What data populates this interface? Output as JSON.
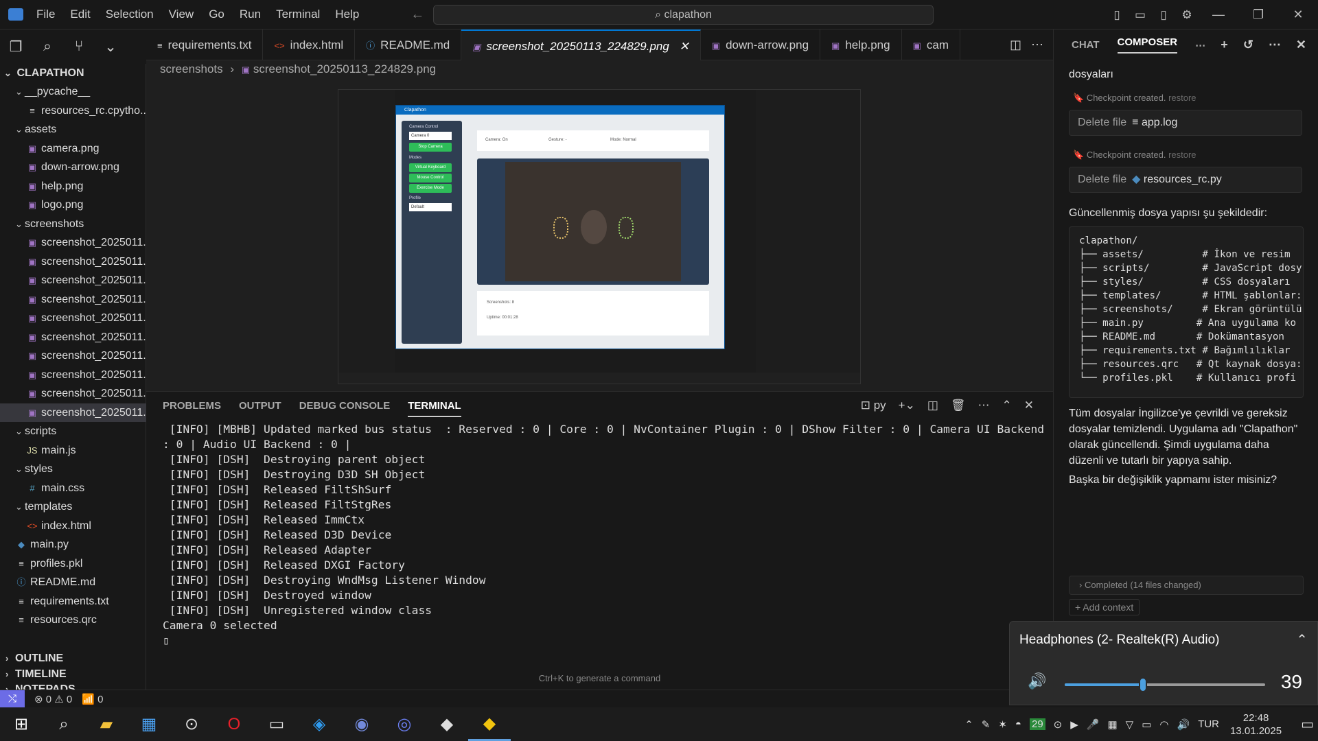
{
  "window": {
    "menu": [
      "File",
      "Edit",
      "Selection",
      "View",
      "Go",
      "Run",
      "Terminal",
      "Help"
    ],
    "command_center": "clapathon"
  },
  "explorer": {
    "root": "CLAPATHON",
    "items": [
      {
        "depth": 1,
        "kind": "folder",
        "label": "__pycache__",
        "icon": "chevron"
      },
      {
        "depth": 2,
        "kind": "file",
        "label": "resources_rc.cpytho...",
        "icon": "txt"
      },
      {
        "depth": 1,
        "kind": "folder",
        "label": "assets",
        "icon": "chevron"
      },
      {
        "depth": 2,
        "kind": "file",
        "label": "camera.png",
        "icon": "img"
      },
      {
        "depth": 2,
        "kind": "file",
        "label": "down-arrow.png",
        "icon": "img"
      },
      {
        "depth": 2,
        "kind": "file",
        "label": "help.png",
        "icon": "img"
      },
      {
        "depth": 2,
        "kind": "file",
        "label": "logo.png",
        "icon": "img"
      },
      {
        "depth": 1,
        "kind": "folder",
        "label": "screenshots",
        "icon": "chevron"
      },
      {
        "depth": 2,
        "kind": "file",
        "label": "screenshot_2025011...",
        "icon": "img"
      },
      {
        "depth": 2,
        "kind": "file",
        "label": "screenshot_2025011...",
        "icon": "img"
      },
      {
        "depth": 2,
        "kind": "file",
        "label": "screenshot_2025011...",
        "icon": "img"
      },
      {
        "depth": 2,
        "kind": "file",
        "label": "screenshot_2025011...",
        "icon": "img"
      },
      {
        "depth": 2,
        "kind": "file",
        "label": "screenshot_2025011...",
        "icon": "img"
      },
      {
        "depth": 2,
        "kind": "file",
        "label": "screenshot_2025011...",
        "icon": "img"
      },
      {
        "depth": 2,
        "kind": "file",
        "label": "screenshot_2025011...",
        "icon": "img"
      },
      {
        "depth": 2,
        "kind": "file",
        "label": "screenshot_2025011...",
        "icon": "img"
      },
      {
        "depth": 2,
        "kind": "file",
        "label": "screenshot_2025011...",
        "icon": "img"
      },
      {
        "depth": 2,
        "kind": "file",
        "label": "screenshot_2025011...",
        "icon": "img",
        "selected": true
      },
      {
        "depth": 1,
        "kind": "folder",
        "label": "scripts",
        "icon": "chevron"
      },
      {
        "depth": 2,
        "kind": "file",
        "label": "main.js",
        "icon": "js"
      },
      {
        "depth": 1,
        "kind": "folder",
        "label": "styles",
        "icon": "chevron"
      },
      {
        "depth": 2,
        "kind": "file",
        "label": "main.css",
        "icon": "css"
      },
      {
        "depth": 1,
        "kind": "folder",
        "label": "templates",
        "icon": "chevron"
      },
      {
        "depth": 2,
        "kind": "file",
        "label": "index.html",
        "icon": "html"
      },
      {
        "depth": 1,
        "kind": "file",
        "label": "main.py",
        "icon": "py"
      },
      {
        "depth": 1,
        "kind": "file",
        "label": "profiles.pkl",
        "icon": "txt"
      },
      {
        "depth": 1,
        "kind": "file",
        "label": "README.md",
        "icon": "info"
      },
      {
        "depth": 1,
        "kind": "file",
        "label": "requirements.txt",
        "icon": "txt"
      },
      {
        "depth": 1,
        "kind": "file",
        "label": "resources.qrc",
        "icon": "txt"
      }
    ],
    "sections": [
      "OUTLINE",
      "TIMELINE",
      "NOTEPADS"
    ]
  },
  "tabs": [
    {
      "label": "requirements.txt",
      "icon": "txt"
    },
    {
      "label": "index.html",
      "icon": "html"
    },
    {
      "label": "README.md",
      "icon": "info"
    },
    {
      "label": "screenshot_20250113_224829.png",
      "icon": "img",
      "active": true
    },
    {
      "label": "down-arrow.png",
      "icon": "img"
    },
    {
      "label": "help.png",
      "icon": "img"
    },
    {
      "label": "cam",
      "icon": "img"
    }
  ],
  "breadcrumb": {
    "folder": "screenshots",
    "file": "screenshot_20250113_224829.png"
  },
  "preview": {
    "app_title": "Clapathon",
    "camera_control": "Camera Control",
    "camera_select": "Camera 0",
    "stop_camera": "Stop Camera",
    "modes": "Modes",
    "mode_buttons": [
      "Virtual Keyboard",
      "Mouse Control",
      "Exercise Mode"
    ],
    "profile": "Profile",
    "profile_value": "Default",
    "status_camera": "Camera: On",
    "status_gesture": "Gesture: -",
    "status_mode": "Mode: Normal",
    "screenshots": "Screenshots: 8",
    "uptime": "Uptime: 00:01:28"
  },
  "panel": {
    "tabs": [
      "PROBLEMS",
      "OUTPUT",
      "DEBUG CONSOLE",
      "TERMINAL"
    ],
    "active_tab": "TERMINAL",
    "shell": "py",
    "terminal_lines": [
      " [INFO] [MBHB] Updated marked bus status  : Reserved : 0 | Core : 0 | NvContainer Plugin : 0 | DShow Filter : 0 | Camera UI Backend",
      ": 0 | Audio UI Backend : 0 |",
      " [INFO] [DSH]  Destroying parent object",
      " [INFO] [DSH]  Destroying D3D SH Object",
      " [INFO] [DSH]  Released FiltShSurf",
      " [INFO] [DSH]  Released FiltStgRes",
      " [INFO] [DSH]  Released ImmCtx",
      " [INFO] [DSH]  Released D3D Device",
      " [INFO] [DSH]  Released Adapter",
      " [INFO] [DSH]  Released DXGI Factory",
      " [INFO] [DSH]  Destroying WndMsg Listener Window",
      " [INFO] [DSH]  Destroyed window",
      " [INFO] [DSH]  Unregistered window class",
      "Camera 0 selected"
    ],
    "hint": "Ctrl+K to generate a command"
  },
  "statusbar": {
    "errors": "0",
    "warnings": "0",
    "ports": "0"
  },
  "chat": {
    "tabs": [
      "CHAT",
      "COMPOSER"
    ],
    "active_tab": "COMPOSER",
    "intro_tail": "dosyaları",
    "checkpoint_text": "Checkpoint created.",
    "restore": "restore",
    "delete_label": "Delete file",
    "deleted_files": [
      "app.log",
      "resources_rc.py"
    ],
    "structure_intro": "Güncellenmiş dosya yapısı şu şekildedir:",
    "code_lines": [
      "clapathon/",
      "├── assets/          # İkon ve resim",
      "├── scripts/         # JavaScript dosy",
      "├── styles/          # CSS dosyaları",
      "├── templates/       # HTML şablonlar:",
      "├── screenshots/     # Ekran görüntülü",
      "├── main.py         # Ana uygulama ko",
      "├── README.md       # Dokümantasyon",
      "├── requirements.txt # Bağımlılıklar",
      "├── resources.qrc   # Qt kaynak dosya:",
      "└── profiles.pkl    # Kullanıcı profi"
    ],
    "summary": "Tüm dosyalar İngilizce'ye çevrildi ve gereksiz dosyalar temizlendi. Uygulama adı \"Clapathon\" olarak güncellendi. Şimdi uygulama daha düzenli ve tutarlı bir yapıya sahip.",
    "question": "Başka bir değişiklik yapmamı ister misiniz?",
    "completed": "Completed (14 files changed)",
    "add_context": "+ Add context"
  },
  "volume": {
    "device": "Headphones (2- Realtek(R) Audio)",
    "level": 39
  },
  "taskbar": {
    "lang": "TUR",
    "time": "22:48",
    "date": "13.01.2025",
    "badge": "29"
  }
}
